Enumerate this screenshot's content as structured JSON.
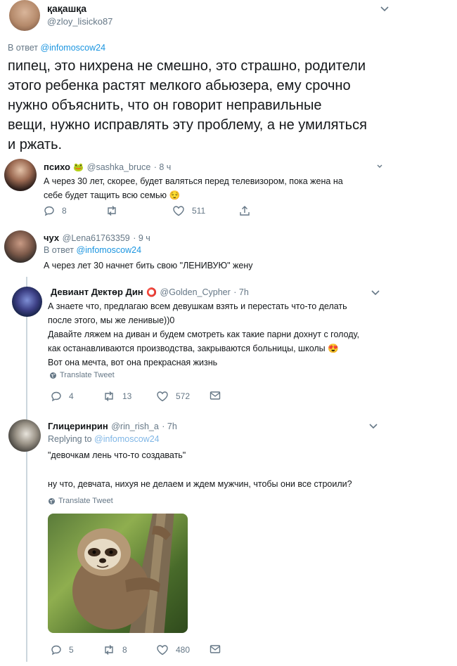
{
  "tweet_main": {
    "name": "қақашқа",
    "handle": "@zloy_lisicko87",
    "reply_prefix": "В ответ",
    "reply_mention": "@infomoscow24",
    "text_lines": [
      "пипец, это нихрена не смешно, это страшно, родители",
      "этого ребенка растят мелкого абьюзера, ему срочно",
      "нужно объяснить, что он говорит неправильные",
      "вещи, нужно исправлять эту проблему, а не умиляться",
      "и ржать."
    ]
  },
  "reply1": {
    "name": "психо",
    "emoji": "🐸",
    "handle": "@sashka_bruce",
    "time": "· 8 ч",
    "text_lines": [
      "А через 30 лет, скорее, будет валяться перед телевизором, пока жена на",
      "себе будет тащить всю семью 😌"
    ],
    "replies": "8",
    "retweets": "",
    "likes": "511"
  },
  "reply2": {
    "name": "чух",
    "handle": "@Lena61763359",
    "time": "· 9 ч",
    "reply_prefix": "В ответ",
    "reply_mention": "@infomoscow24",
    "text": "А через лет 30 начнет бить свою \"ЛЕНИВУЮ\" жену"
  },
  "reply3": {
    "name": "Девиант Дɐктɵр Дин",
    "emoji": "⭕",
    "handle": "@Golden_Cypher",
    "time": "· 7h",
    "text_lines": [
      "А знаете что, предлагаю всем девушкам взять и перестать что-то делать",
      "после этого, мы же ленивые))0",
      "Давайте ляжем на диван и будем смотреть как такие парни дохнут с голоду,",
      "как останавливаются производства, закрываются больницы, школы 😍",
      "Вот она мечта, вот она прекрасная жизнь"
    ],
    "translate": "Translate Tweet",
    "replies": "4",
    "retweets": "13",
    "likes": "572"
  },
  "reply4": {
    "name": "Глицеринрин",
    "handle": "@rin_rish_a",
    "time": "· 7h",
    "reply_prefix": "Replying to",
    "reply_mention": "@infomoscow24",
    "text_line1": "\"девочкам лень что-то создавать\"",
    "text_line2": "ну что, девчата, нихуя не делаем и ждем мужчин, чтобы они все строили?",
    "translate": "Translate Tweet",
    "replies": "5",
    "retweets": "8",
    "likes": "480"
  },
  "colors": {
    "text": "#14171a",
    "secondary": "#657786",
    "link": "#1b95e0",
    "thread_line": "#ccd6dd"
  }
}
